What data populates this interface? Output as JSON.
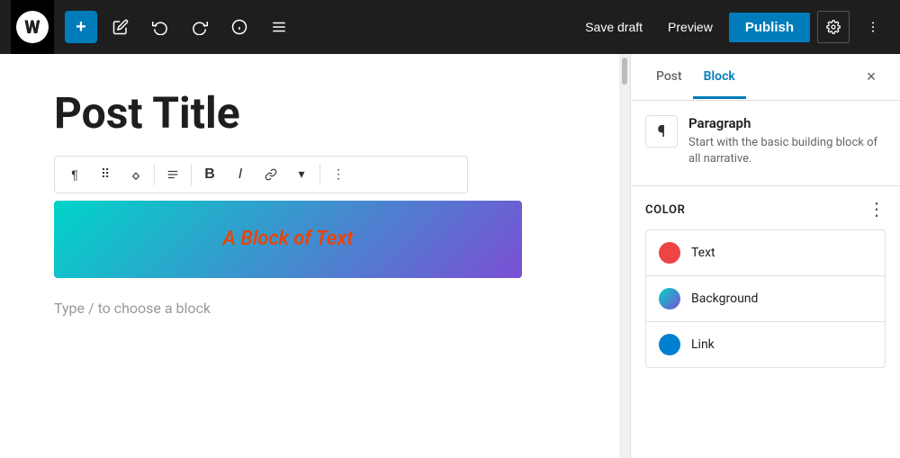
{
  "toolbar": {
    "wp_logo": "W",
    "add_label": "+",
    "undo_label": "↩",
    "redo_label": "↪",
    "info_label": "ⓘ",
    "list_view_label": "≡",
    "save_draft_label": "Save draft",
    "preview_label": "Preview",
    "publish_label": "Publish",
    "settings_label": "⚙",
    "more_label": "⋮"
  },
  "block_toolbar": {
    "paragraph_icon": "¶",
    "drag_icon": "⠿",
    "arrows_icon": "⇅",
    "align_icon": "≡",
    "bold_label": "B",
    "italic_label": "I",
    "link_label": "⌁",
    "chevron_label": "▾",
    "more_label": "⋮"
  },
  "editor": {
    "post_title": "Post Title",
    "block_text": "A Block of Text",
    "placeholder": "Type / to choose a block"
  },
  "sidebar": {
    "post_tab": "Post",
    "block_tab": "Block",
    "close_label": "×",
    "block_icon": "¶",
    "block_name": "Paragraph",
    "block_description": "Start with the basic building block of all narrative.",
    "color_section_title": "Color",
    "color_more_label": "⋮",
    "color_options": [
      {
        "label": "Text",
        "color": "#e44"
      },
      {
        "label": "Background",
        "color": "linear-gradient(135deg, #00d4c8, #7b4fd4)"
      },
      {
        "label": "Link",
        "color": "#0080d0"
      }
    ]
  }
}
